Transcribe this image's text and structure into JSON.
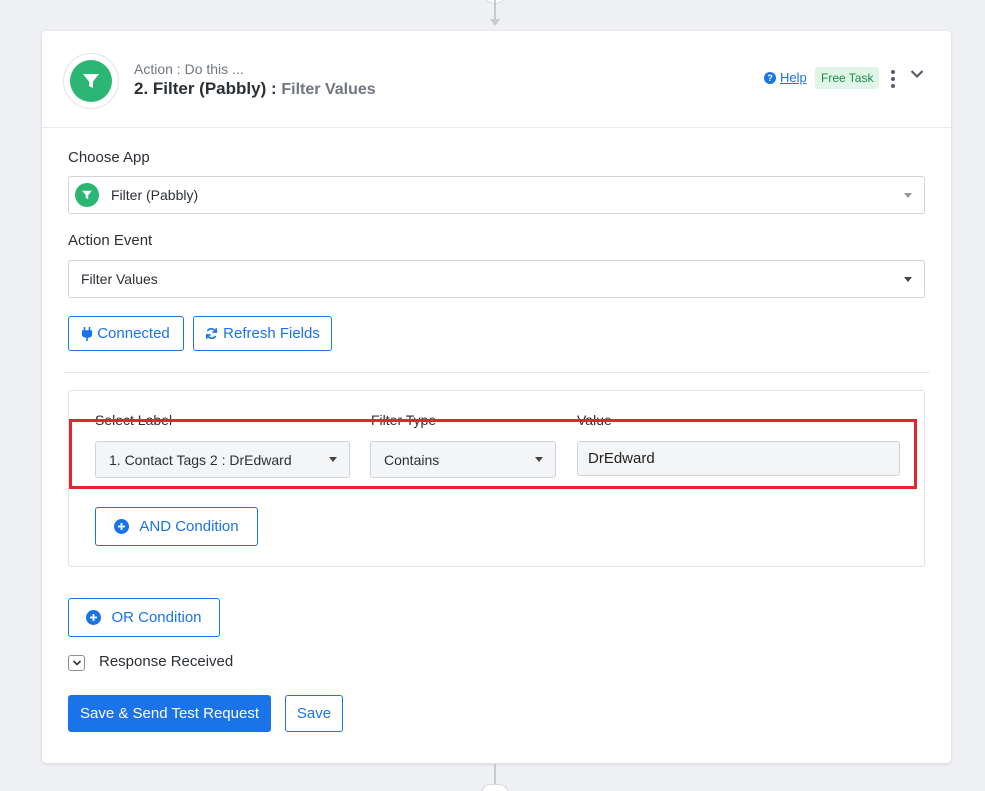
{
  "header": {
    "caption": "Action : Do this ...",
    "title": "2. Filter (Pabbly) :",
    "subtitle": "Filter Values",
    "help_label": "Help",
    "badge": "Free Task"
  },
  "choose_app": {
    "label": "Choose App",
    "value": "Filter (Pabbly)"
  },
  "action_event": {
    "label": "Action Event",
    "value": "Filter Values"
  },
  "buttons": {
    "connected": "Connected",
    "refresh": "Refresh Fields"
  },
  "filter": {
    "col_select_label": "Select Label",
    "col_filter_type": "Filter Type",
    "col_value": "Value",
    "select_label_value": "1. Contact Tags 2 : DrEdward",
    "filter_type_value": "Contains",
    "value": "DrEdward",
    "and_condition": "AND Condition"
  },
  "or_condition": "OR Condition",
  "response_received": "Response Received",
  "save_test": "Save & Send Test Request",
  "save": "Save",
  "colors": {
    "accent": "#1a73e8",
    "brand_green": "#2bb673",
    "highlight": "#e3262d"
  }
}
